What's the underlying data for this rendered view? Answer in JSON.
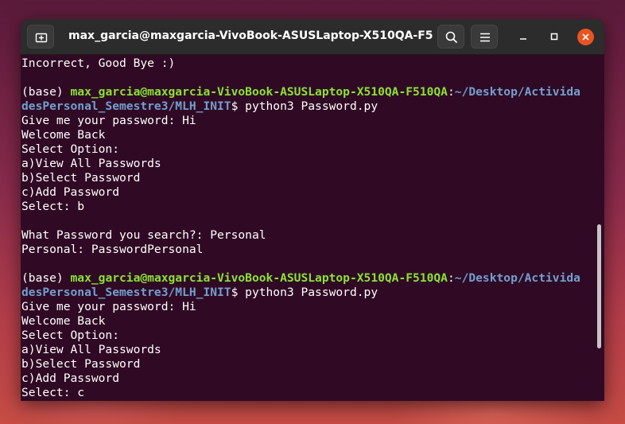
{
  "window": {
    "title": "max_garcia@maxgarcia-VivoBook-ASUSLaptop-X510QA-F510...",
    "new_tab_icon": "new-tab-icon",
    "search_icon": "search-icon",
    "menu_icon": "hamburger-menu-icon",
    "minimize_icon": "minimize-icon",
    "maximize_icon": "maximize-icon",
    "close_icon": "close-icon"
  },
  "colors": {
    "terminal_bg": "#300a24",
    "prompt_user": "#8ae234",
    "prompt_path": "#729fcf",
    "close_button": "#e95420"
  },
  "terminal": {
    "line_0": "Incorrect, Good Bye :)",
    "prompt1": {
      "env": "(base) ",
      "user": "max_garcia@maxgarcia-VivoBook-ASUSLaptop-X510QA-F510QA",
      "colon": ":",
      "path_a": "~/Desktop/Activida",
      "path_b": "desPersonal_Semestre3/MLH_INIT",
      "cmd": "$ python3 Password.py"
    },
    "block1": [
      "Give me your password: Hi",
      "Welcome Back",
      "Select Option:",
      "a)View All Passwords",
      "b)Select Password",
      "c)Add Password",
      "Select: b"
    ],
    "result1": [
      "What Password you search?: Personal",
      "Personal: PasswordPersonal"
    ],
    "prompt2": {
      "env": "(base) ",
      "user": "max_garcia@maxgarcia-VivoBook-ASUSLaptop-X510QA-F510QA",
      "colon": ":",
      "path_a": "~/Desktop/Activida",
      "path_b": "desPersonal_Semestre3/MLH_INIT",
      "cmd": "$ python3 Password.py"
    },
    "block2": [
      "Give me your password: Hi",
      "Welcome Back",
      "Select Option:",
      "a)View All Passwords",
      "b)Select Password",
      "c)Add Password",
      "Select: c"
    ]
  }
}
